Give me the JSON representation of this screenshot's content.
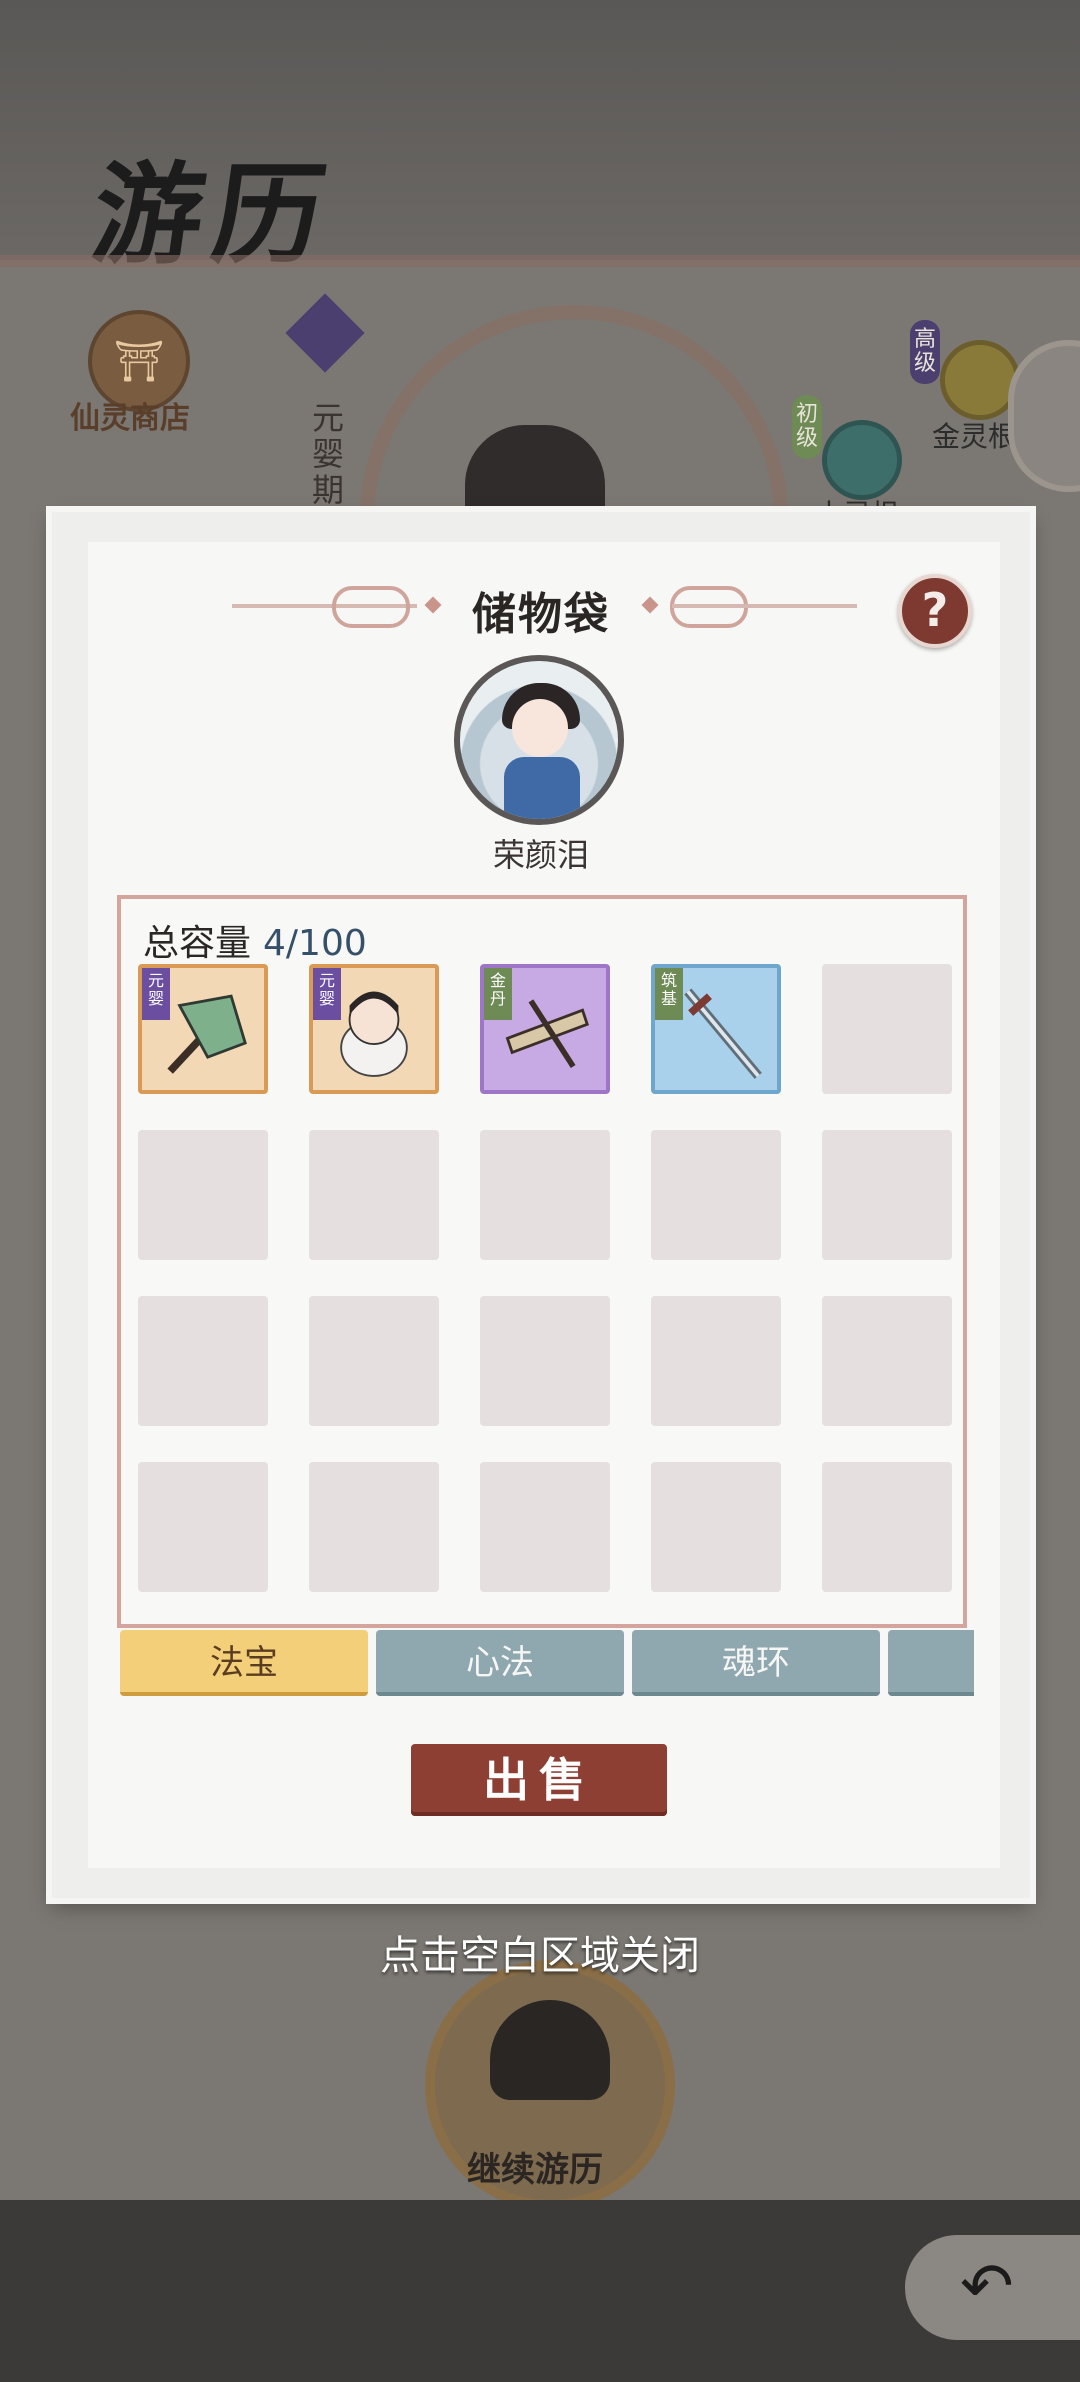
{
  "background": {
    "title": "游历",
    "shop": {
      "label": "仙灵商店",
      "icon": "temple-icon"
    },
    "realm": "元婴期",
    "roots": [
      {
        "tag": "高级",
        "label": "金灵根"
      },
      {
        "tag": "初级",
        "label": "木灵根"
      }
    ],
    "continue_label": "继续游历",
    "back_icon": "back-arrow-icon"
  },
  "modal": {
    "title": "储物袋",
    "help": "?",
    "player_name": "荣颜泪",
    "capacity_label": "总容量",
    "capacity_value": "4/100",
    "items": [
      {
        "tag": "元婴",
        "rarity": "orange",
        "icon": "banner-weapon-icon"
      },
      {
        "tag": "元婴",
        "rarity": "orange",
        "icon": "doll-icon"
      },
      {
        "tag": "金丹",
        "rarity": "purple",
        "icon": "crossbow-icon"
      },
      {
        "tag": "筑基",
        "rarity": "blue",
        "icon": "sword-icon"
      }
    ],
    "tabs": [
      {
        "label": "法宝",
        "active": true
      },
      {
        "label": "心法",
        "active": false
      },
      {
        "label": "魂环",
        "active": false
      },
      {
        "label": "",
        "active": false
      }
    ],
    "sell_label": "出售"
  },
  "close_hint": "点击空白区域关闭"
}
